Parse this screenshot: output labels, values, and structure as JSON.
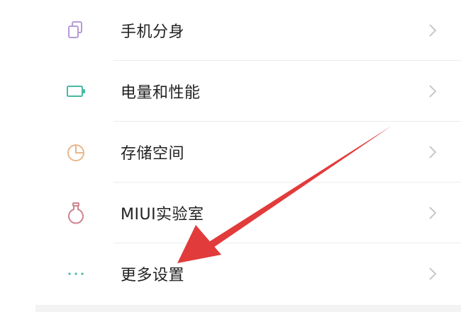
{
  "settings": {
    "items": [
      {
        "label": "手机分身",
        "icon": "dual-app-icon",
        "color": "#b69ad6"
      },
      {
        "label": "电量和性能",
        "icon": "battery-icon",
        "color": "#4bb8a4"
      },
      {
        "label": "存储空间",
        "icon": "storage-pie-icon",
        "color": "#e8b78a"
      },
      {
        "label": "MIUI实验室",
        "icon": "lab-flask-icon",
        "color": "#d0838f"
      },
      {
        "label": "更多设置",
        "icon": "more-dots-icon",
        "color": "#4bb8a4"
      }
    ]
  },
  "annotation": {
    "arrow_color": "#e23b3b"
  }
}
